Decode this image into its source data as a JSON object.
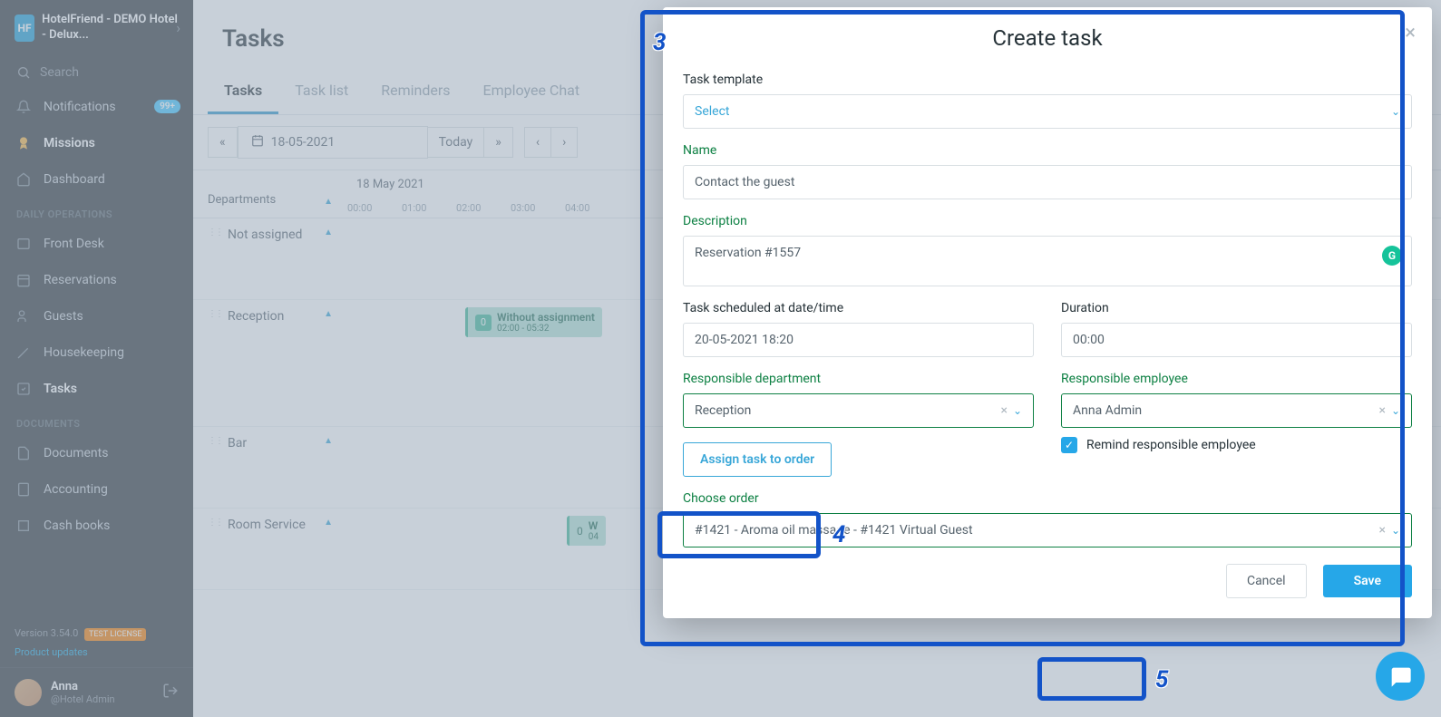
{
  "sidebar": {
    "hotel_name": "HotelFriend - DEMO Hotel - Delux...",
    "search_placeholder": "Search",
    "notifications_label": "Notifications",
    "notifications_badge": "99+",
    "missions_label": "Missions",
    "dashboard_label": "Dashboard",
    "section_daily": "DAILY OPERATIONS",
    "section_docs": "DOCUMENTS",
    "items_daily": [
      {
        "label": "Front Desk"
      },
      {
        "label": "Reservations"
      },
      {
        "label": "Guests"
      },
      {
        "label": "Housekeeping"
      },
      {
        "label": "Tasks"
      }
    ],
    "items_docs": [
      {
        "label": "Documents"
      },
      {
        "label": "Accounting"
      },
      {
        "label": "Cash books"
      }
    ],
    "version": "Version 3.54.0",
    "license_tag": "TEST LICENSE",
    "product_updates": "Product updates",
    "user_name": "Anna",
    "user_role": "@Hotel Admin"
  },
  "page": {
    "title": "Tasks",
    "tabs": [
      "Tasks",
      "Task list",
      "Reminders",
      "Employee Chat"
    ],
    "date": "18-05-2021",
    "today_label": "Today",
    "schedule_date": "18 May 2021",
    "dept_header": "Departments",
    "hours": [
      "00:00",
      "01:00",
      "02:00",
      "03:00",
      "04:00"
    ],
    "rows": [
      "Not assigned",
      "Reception",
      "Bar",
      "Room Service"
    ],
    "task_chip": {
      "count": "0",
      "title": "Without assignment",
      "time": "02:00 - 05:32"
    },
    "task_chip2": {
      "count": "0",
      "title": "W",
      "time": "04"
    }
  },
  "modal": {
    "title": "Create task",
    "labels": {
      "template": "Task template",
      "name": "Name",
      "description": "Description",
      "scheduled": "Task scheduled at date/time",
      "duration": "Duration",
      "department": "Responsible department",
      "employee": "Responsible employee",
      "assign_order": "Assign task to order",
      "remind": "Remind responsible employee",
      "choose_order": "Choose order"
    },
    "values": {
      "template_placeholder": "Select",
      "name": "Contact the guest",
      "description": "Reservation #1557",
      "scheduled": "20-05-2021 18:20",
      "duration": "00:00",
      "department": "Reception",
      "employee": "Anna Admin",
      "order": "#1421 - Aroma oil massage - #1421 Virtual Guest"
    },
    "buttons": {
      "cancel": "Cancel",
      "save": "Save"
    }
  },
  "callouts": {
    "c3": "3",
    "c4": "4",
    "c5": "5"
  }
}
